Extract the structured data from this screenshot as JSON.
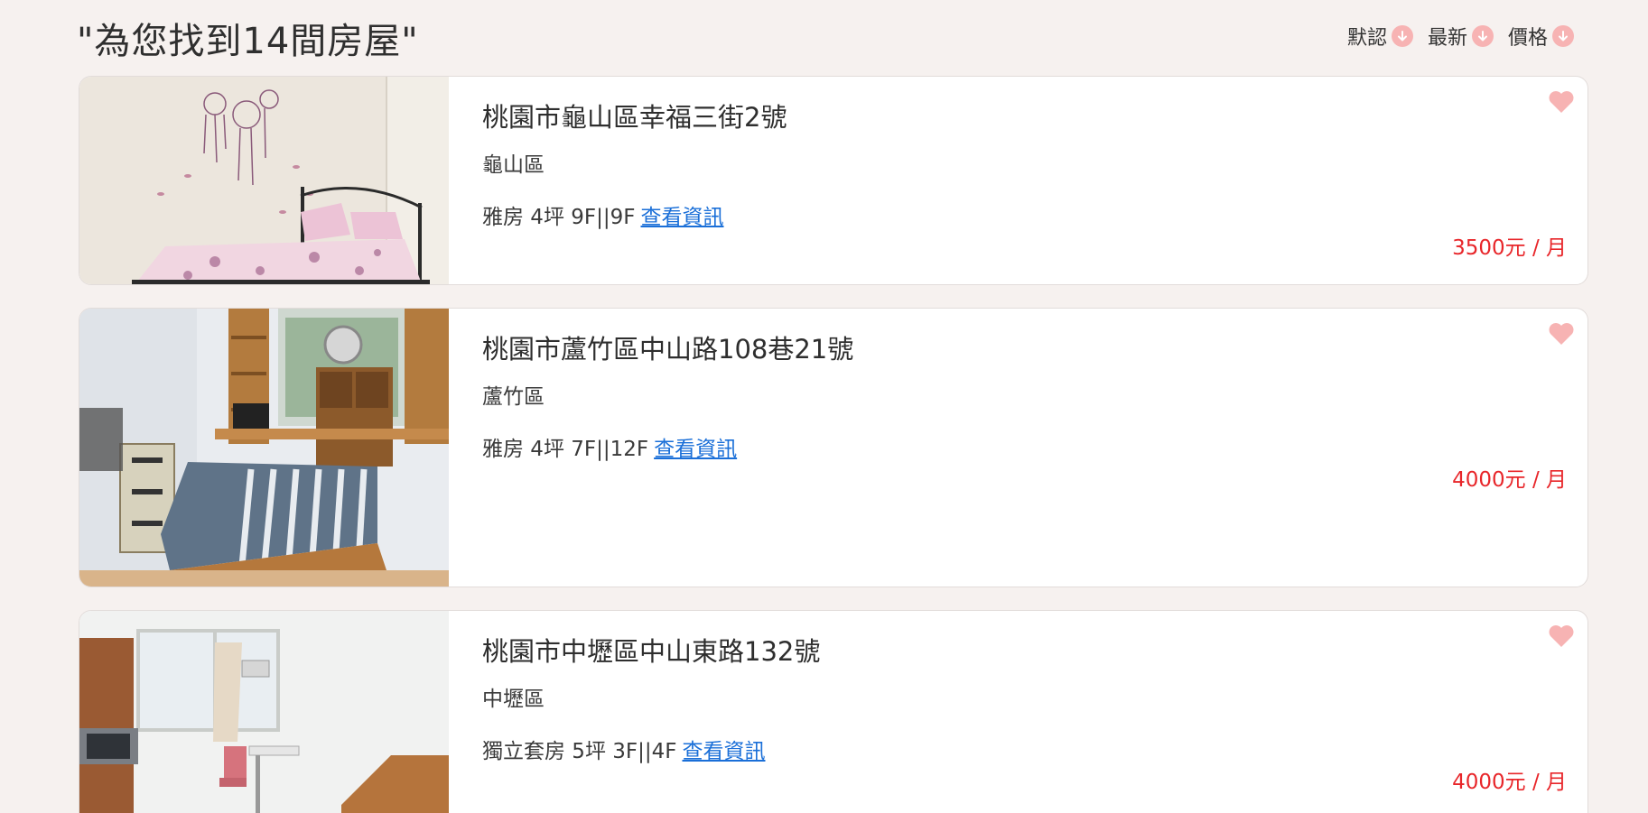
{
  "results": {
    "title": "\"為您找到14間房屋\""
  },
  "sort": {
    "default_label": "默認",
    "newest_label": "最新",
    "price_label": "價格",
    "icon": "arrow-down-circle-icon",
    "icon_color": "#f7b3b3"
  },
  "favorite": {
    "icon": "heart-icon",
    "color": "#f7b3b3"
  },
  "colors": {
    "background": "#f6f1ef",
    "price": "#e8262a",
    "link": "#1a6fd8"
  },
  "listings": [
    {
      "address": "桃園市龜山區幸福三街2號",
      "district": "龜山區",
      "details": "雅房 4坪 9F||9F",
      "link_label": "查看資訊",
      "price": "3500元 / 月"
    },
    {
      "address": "桃園市蘆竹區中山路108巷21號",
      "district": "蘆竹區",
      "details": "雅房 4坪 7F||12F",
      "link_label": "查看資訊",
      "price": "4000元 / 月"
    },
    {
      "address": "桃園市中壢區中山東路132號",
      "district": "中壢區",
      "details": "獨立套房 5坪 3F||4F",
      "link_label": "查看資訊",
      "price": "4000元 / 月"
    }
  ]
}
